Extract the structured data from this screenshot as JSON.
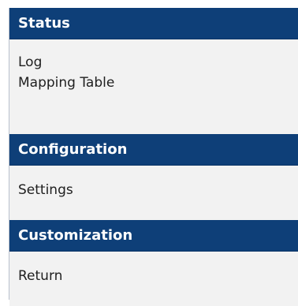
{
  "menu": {
    "sections": [
      {
        "header": "Status",
        "items": [
          "Log",
          "Mapping Table"
        ]
      },
      {
        "header": "Configuration",
        "items": [
          "Settings"
        ]
      },
      {
        "header": "Customization",
        "items": [
          "Return"
        ]
      }
    ]
  },
  "colors": {
    "header_bg": "#0e3f78",
    "section_bg": "#f2f2f2",
    "header_text": "#ffffff",
    "item_text": "#202020"
  }
}
